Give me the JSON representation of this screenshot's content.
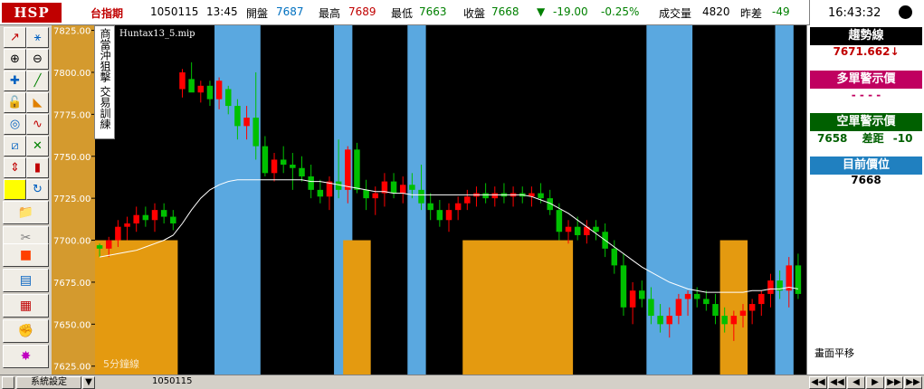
{
  "topbar": {
    "logo": "HSP",
    "symbol": "台指期",
    "date": "1050115",
    "time": "13:45",
    "open_label": "開盤",
    "open_value": "7687",
    "high_label": "最高",
    "high_value": "7689",
    "low_label": "最低",
    "low_value": "7663",
    "close_label": "收盤",
    "close_value": "7668",
    "change_arrow": "▼",
    "change_value": "-19.00",
    "change_pct": "-0.25%",
    "volume_label": "成交量",
    "volume_value": "4820",
    "spread_label": "昨差",
    "spread_value": "-49",
    "clock": "16:43:32"
  },
  "chart_overlay": {
    "study_name": "Huntax13_5.mip",
    "vertical_label_1": "商當沖狙擊",
    "vertical_label_2": "交易訓練",
    "period_label": "5分鐘線"
  },
  "right_panel": {
    "trend_header": "趨勢線",
    "trend_value": "7671.662↓",
    "long_header": "多單警示價",
    "long_value": "- - - -",
    "short_header": "空單警示價",
    "short_value": "7658",
    "short_diff_label": "差距",
    "short_diff_value": "-10",
    "current_header": "目前價位",
    "current_value": "7668",
    "shift_label": "畫面平移"
  },
  "bottombar": {
    "settings_label": "系統設定",
    "arrow_glyph": "▼",
    "date_label": "1050115",
    "nav": [
      "◀◀",
      "◀◀",
      "◀",
      "▶",
      "▶▶",
      "▶▶"
    ]
  },
  "colors": {
    "bg": "#000000",
    "up_candle": "#ff0000",
    "down_candle": "#00c000",
    "short_zone": "#5aa8e0",
    "long_zone": "#e49a10",
    "axis_bg": "#d49a2e",
    "trend_line": "#ffffff"
  },
  "chart_data": {
    "type": "candlestick",
    "interval": "5分鐘線",
    "ylim": [
      7620,
      7828
    ],
    "y_ticks": [
      7825,
      7800,
      7775,
      7750,
      7725,
      7700,
      7675,
      7650,
      7625
    ],
    "candles": [
      [
        7697,
        7698,
        7690,
        7695
      ],
      [
        7695,
        7702,
        7690,
        7700
      ],
      [
        7700,
        7712,
        7696,
        7708
      ],
      [
        7708,
        7714,
        7700,
        7710
      ],
      [
        7710,
        7720,
        7705,
        7715
      ],
      [
        7715,
        7720,
        7708,
        7712
      ],
      [
        7712,
        7722,
        7705,
        7718
      ],
      [
        7718,
        7722,
        7710,
        7714
      ],
      [
        7714,
        7718,
        7706,
        7710
      ],
      [
        7790,
        7802,
        7785,
        7800
      ],
      [
        7796,
        7806,
        7790,
        7788
      ],
      [
        7788,
        7795,
        7782,
        7792
      ],
      [
        7792,
        7795,
        7780,
        7784
      ],
      [
        7784,
        7797,
        7778,
        7795
      ],
      [
        7790,
        7792,
        7775,
        7780
      ],
      [
        7780,
        7784,
        7760,
        7768
      ],
      [
        7768,
        7780,
        7760,
        7773
      ],
      [
        7773,
        7800,
        7748,
        7756
      ],
      [
        7756,
        7762,
        7738,
        7740
      ],
      [
        7740,
        7752,
        7735,
        7748
      ],
      [
        7748,
        7756,
        7740,
        7745
      ],
      [
        7745,
        7752,
        7730,
        7743
      ],
      [
        7743,
        7750,
        7735,
        7738
      ],
      [
        7738,
        7745,
        7725,
        7730
      ],
      [
        7730,
        7736,
        7722,
        7726
      ],
      [
        7726,
        7738,
        7718,
        7735
      ],
      [
        7735,
        7760,
        7725,
        7730
      ],
      [
        7730,
        7756,
        7722,
        7754
      ],
      [
        7754,
        7758,
        7728,
        7730
      ],
      [
        7730,
        7736,
        7718,
        7725
      ],
      [
        7725,
        7732,
        7715,
        7728
      ],
      [
        7728,
        7740,
        7720,
        7735
      ],
      [
        7735,
        7740,
        7725,
        7728
      ],
      [
        7728,
        7738,
        7722,
        7733
      ],
      [
        7733,
        7740,
        7725,
        7730
      ],
      [
        7730,
        7745,
        7718,
        7722
      ],
      [
        7722,
        7728,
        7712,
        7718
      ],
      [
        7718,
        7724,
        7708,
        7712
      ],
      [
        7712,
        7722,
        7705,
        7718
      ],
      [
        7718,
        7726,
        7712,
        7722
      ],
      [
        7722,
        7730,
        7718,
        7726
      ],
      [
        7726,
        7732,
        7720,
        7728
      ],
      [
        7728,
        7734,
        7722,
        7725
      ],
      [
        7725,
        7732,
        7720,
        7728
      ],
      [
        7728,
        7734,
        7722,
        7726
      ],
      [
        7726,
        7732,
        7720,
        7728
      ],
      [
        7728,
        7732,
        7722,
        7726
      ],
      [
        7726,
        7732,
        7720,
        7728
      ],
      [
        7728,
        7734,
        7722,
        7725
      ],
      [
        7725,
        7730,
        7715,
        7718
      ],
      [
        7718,
        7722,
        7700,
        7705
      ],
      [
        7705,
        7712,
        7698,
        7708
      ],
      [
        7708,
        7714,
        7700,
        7703
      ],
      [
        7703,
        7712,
        7698,
        7708
      ],
      [
        7708,
        7712,
        7700,
        7705
      ],
      [
        7705,
        7710,
        7690,
        7695
      ],
      [
        7695,
        7700,
        7680,
        7685
      ],
      [
        7685,
        7692,
        7655,
        7660
      ],
      [
        7660,
        7675,
        7650,
        7670
      ],
      [
        7670,
        7676,
        7660,
        7665
      ],
      [
        7665,
        7672,
        7650,
        7655
      ],
      [
        7655,
        7662,
        7645,
        7650
      ],
      [
        7650,
        7660,
        7642,
        7655
      ],
      [
        7655,
        7668,
        7650,
        7665
      ],
      [
        7665,
        7670,
        7655,
        7668
      ],
      [
        7668,
        7672,
        7660,
        7665
      ],
      [
        7665,
        7670,
        7658,
        7662
      ],
      [
        7662,
        7668,
        7650,
        7655
      ],
      [
        7655,
        7660,
        7645,
        7650
      ],
      [
        7650,
        7658,
        7640,
        7655
      ],
      [
        7655,
        7662,
        7648,
        7658
      ],
      [
        7658,
        7665,
        7650,
        7662
      ],
      [
        7662,
        7670,
        7655,
        7668
      ],
      [
        7668,
        7680,
        7660,
        7676
      ],
      [
        7676,
        7682,
        7665,
        7670
      ],
      [
        7670,
        7690,
        7660,
        7685
      ],
      [
        7685,
        7692,
        7665,
        7668
      ]
    ],
    "trend_line": [
      7690,
      7691,
      7692,
      7693,
      7694,
      7696,
      7698,
      7700,
      7703,
      7710,
      7718,
      7725,
      7730,
      7733,
      7735,
      7736,
      7736,
      7736,
      7736,
      7736,
      7736,
      7736,
      7736,
      7735,
      7735,
      7734,
      7733,
      7732,
      7731,
      7730,
      7729,
      7729,
      7728,
      7728,
      7727,
      7727,
      7727,
      7727,
      7727,
      7727,
      7727,
      7727,
      7727,
      7727,
      7727,
      7727,
      7727,
      7726,
      7724,
      7722,
      7719,
      7716,
      7712,
      7708,
      7704,
      7700,
      7696,
      7692,
      7688,
      7684,
      7681,
      7678,
      7675,
      7673,
      7671,
      7670,
      7669,
      7669,
      7669,
      7669,
      7669,
      7670,
      7670,
      7671,
      7671,
      7672,
      7671
    ],
    "short_zones": [
      [
        0,
        0
      ],
      [
        13,
        17
      ],
      [
        26,
        27
      ],
      [
        34,
        35
      ],
      [
        60,
        64
      ],
      [
        74,
        75
      ]
    ],
    "long_zones": [
      [
        0,
        8
      ],
      [
        27,
        29
      ],
      [
        40,
        51
      ],
      [
        68,
        70
      ]
    ]
  }
}
